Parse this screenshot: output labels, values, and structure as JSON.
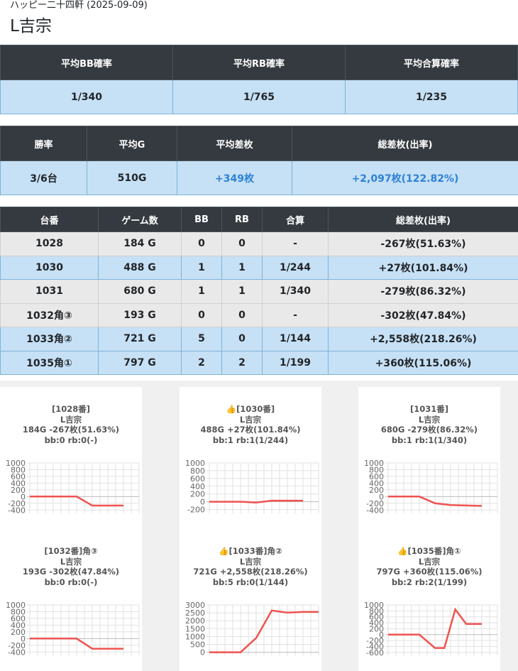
{
  "header": {
    "subtitle": "ハッピー二十四軒 (2025-09-09)",
    "title": "L吉宗"
  },
  "summary1": {
    "headers": [
      "平均BB確率",
      "平均RB確率",
      "平均合算確率"
    ],
    "values": [
      "1/340",
      "1/765",
      "1/235"
    ]
  },
  "summary2": {
    "headers": [
      "勝率",
      "平均G",
      "平均差枚",
      "総差枚(出率)"
    ],
    "values": [
      "3/6台",
      "510G",
      "+349枚",
      "+2,097枚(122.82%)"
    ]
  },
  "machines": {
    "headers": [
      "台番",
      "ゲーム数",
      "BB",
      "RB",
      "合算",
      "総差枚(出率)"
    ],
    "rows": [
      {
        "id": "1028",
        "games": "184 G",
        "bb": "0",
        "rb": "0",
        "total": "-",
        "diff": "-267枚(51.63%)"
      },
      {
        "id": "1030",
        "games": "488 G",
        "bb": "1",
        "rb": "1",
        "total": "1/244",
        "diff": "+27枚(101.84%)"
      },
      {
        "id": "1031",
        "games": "680 G",
        "bb": "1",
        "rb": "1",
        "total": "1/340",
        "diff": "-279枚(86.32%)"
      },
      {
        "id": "1032角③",
        "games": "193 G",
        "bb": "0",
        "rb": "0",
        "total": "-",
        "diff": "-302枚(47.84%)"
      },
      {
        "id": "1033角②",
        "games": "721 G",
        "bb": "5",
        "rb": "0",
        "total": "1/144",
        "diff": "+2,558枚(218.26%)"
      },
      {
        "id": "1035角①",
        "games": "797 G",
        "bb": "2",
        "rb": "2",
        "total": "1/199",
        "diff": "+360枚(115.06%)"
      }
    ]
  },
  "chart_data": [
    {
      "type": "line",
      "title": "[1028番]",
      "name": "L吉宗",
      "line1": "184G -267枚(51.63%)",
      "line2": "bb:0 rb:0(-)",
      "y_ticks": [
        1000,
        800,
        600,
        400,
        200,
        0,
        -200,
        -400
      ],
      "ylim": [
        -500,
        1000
      ],
      "xlim": [
        0,
        7
      ],
      "x": [
        0,
        1,
        2,
        3,
        4,
        5,
        6
      ],
      "y": [
        0,
        0,
        0,
        0,
        -267,
        -267,
        -267
      ]
    },
    {
      "type": "line",
      "title": "👍[1030番]",
      "name": "L吉宗",
      "line1": "488G +27枚(101.84%)",
      "line2": "bb:1 rb:1(1/244)",
      "y_ticks": [
        1000,
        800,
        600,
        400,
        200,
        0,
        -200
      ],
      "ylim": [
        -300,
        1000
      ],
      "xlim": [
        0,
        7
      ],
      "x": [
        0,
        1,
        2,
        3,
        4,
        5,
        6
      ],
      "y": [
        0,
        0,
        0,
        -20,
        27,
        27,
        27
      ]
    },
    {
      "type": "line",
      "title": "[1031番]",
      "name": "L吉宗",
      "line1": "680G -279枚(86.32%)",
      "line2": "bb:1 rb:1(1/340)",
      "y_ticks": [
        1000,
        800,
        600,
        400,
        200,
        0,
        -200,
        -400
      ],
      "ylim": [
        -500,
        1000
      ],
      "xlim": [
        0,
        7
      ],
      "x": [
        0,
        1,
        2,
        3,
        4,
        5,
        6
      ],
      "y": [
        0,
        0,
        0,
        -200,
        -250,
        -265,
        -279
      ]
    },
    {
      "type": "line",
      "title": "[1032番]角③",
      "name": "L吉宗",
      "line1": "193G -302枚(47.84%)",
      "line2": "bb:0 rb:0(-)",
      "y_ticks": [
        1000,
        800,
        600,
        400,
        200,
        0,
        -200,
        -400
      ],
      "ylim": [
        -500,
        1000
      ],
      "xlim": [
        0,
        7
      ],
      "x": [
        0,
        1,
        2,
        3,
        4,
        5,
        6
      ],
      "y": [
        0,
        0,
        0,
        0,
        -302,
        -302,
        -302
      ]
    },
    {
      "type": "line",
      "title": "👍[1033番]角②",
      "name": "L吉宗",
      "line1": "721G +2,558枚(218.26%)",
      "line2": "bb:5 rb:0(1/144)",
      "y_ticks": [
        3000,
        2500,
        2000,
        1500,
        1000,
        500,
        0
      ],
      "ylim": [
        -200,
        3000
      ],
      "xlim": [
        0,
        7
      ],
      "x": [
        0,
        1,
        2,
        3,
        4,
        5,
        6,
        7
      ],
      "y": [
        0,
        0,
        0,
        900,
        2650,
        2520,
        2558,
        2558
      ]
    },
    {
      "type": "line",
      "title": "👍[1035番]角①",
      "name": "L吉宗",
      "line1": "797G +360枚(115.06%)",
      "line2": "bb:2 rb:2(1/199)",
      "y_ticks": [
        1000,
        800,
        600,
        400,
        200,
        0,
        -200,
        -400,
        -600
      ],
      "ylim": [
        -700,
        1000
      ],
      "xlim": [
        0,
        7
      ],
      "x": [
        0,
        1,
        2,
        3,
        3.6,
        4.3,
        5,
        6
      ],
      "y": [
        0,
        0,
        0,
        -450,
        -450,
        850,
        360,
        360
      ]
    }
  ]
}
